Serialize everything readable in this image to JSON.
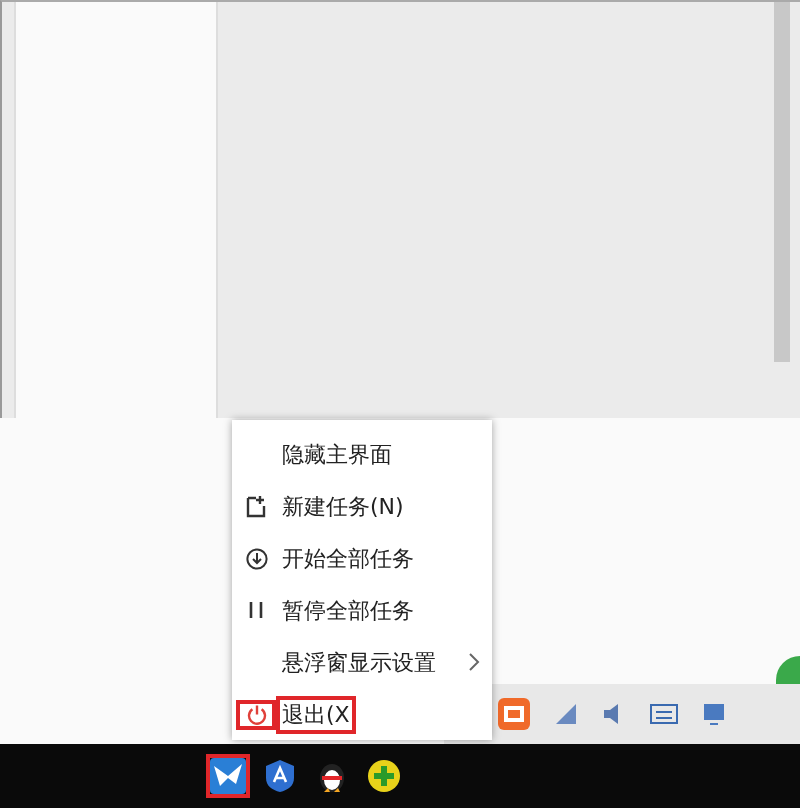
{
  "menu": {
    "items": [
      {
        "label": "隐藏主界面",
        "kind": "plain",
        "highlighted": false
      },
      {
        "label": "新建任务(N)",
        "kind": "new",
        "highlighted": false
      },
      {
        "label": "开始全部任务",
        "kind": "start",
        "highlighted": false
      },
      {
        "label": "暂停全部任务",
        "kind": "pause",
        "highlighted": false
      },
      {
        "label": "悬浮窗显示设置",
        "kind": "submenu",
        "highlighted": false
      },
      {
        "label": "退出(X",
        "kind": "exit",
        "highlighted": true
      }
    ]
  },
  "taskbar": {
    "icons": [
      {
        "kind": "bird",
        "highlighted": true
      },
      {
        "kind": "shield",
        "highlighted": false
      },
      {
        "kind": "penguin",
        "highlighted": false
      },
      {
        "kind": "plus",
        "highlighted": false
      }
    ]
  }
}
